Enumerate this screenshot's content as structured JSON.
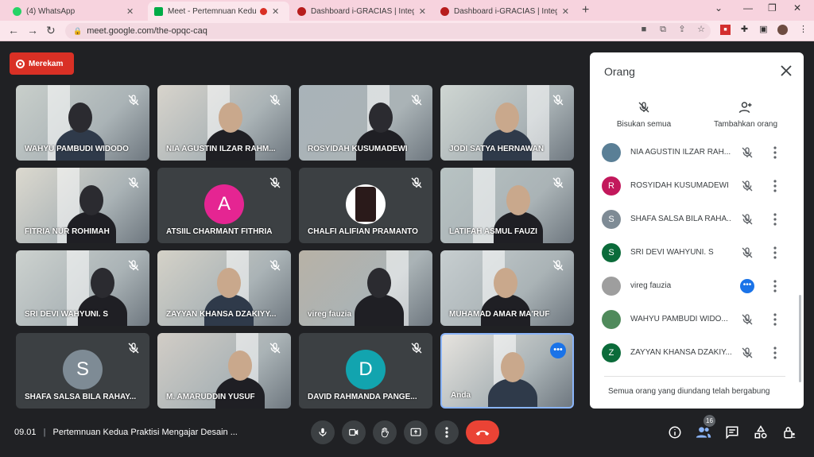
{
  "browser": {
    "tabs": [
      {
        "title": "(4) WhatsApp",
        "color": "#25d366"
      },
      {
        "title": "Meet - Pertemnuan Kedua P",
        "color": "#00ac47"
      },
      {
        "title": "Dashboard i-GRACIAS | Integrate",
        "color": "#b71c1c"
      },
      {
        "title": "Dashboard i-GRACIAS | Integrate",
        "color": "#b71c1c"
      }
    ],
    "url": "meet.google.com/the-opqc-caq",
    "new_tab": "+"
  },
  "recording": {
    "label": "Merekam"
  },
  "tiles": [
    {
      "name": "WAHYU PAMBUDI WIDODO",
      "kind": "video"
    },
    {
      "name": "NIA AGUSTIN ILZAR RAHM...",
      "kind": "video"
    },
    {
      "name": "ROSYIDAH KUSUMADEWI",
      "kind": "video"
    },
    {
      "name": "JODI SATYA HERNAWAN",
      "kind": "video"
    },
    {
      "name": "FITRIA NUR ROHIMAH",
      "kind": "video"
    },
    {
      "name": "ATSIIL CHARMANT FITHRIA",
      "kind": "avatar",
      "initial": "A",
      "color": "#e52592"
    },
    {
      "name": "CHALFI ALIFIAN PRAMANTO",
      "kind": "photo"
    },
    {
      "name": "LATIFAH ASMUL FAUZI",
      "kind": "video"
    },
    {
      "name": "SRI DEVI WAHYUNI. S",
      "kind": "video"
    },
    {
      "name": "ZAYYAN KHANSA DZAKIYY...",
      "kind": "video"
    },
    {
      "name": "vireg fauzia",
      "kind": "video"
    },
    {
      "name": "MUHAMAD AMAR MA'RUF",
      "kind": "video"
    },
    {
      "name": "SHAFA SALSA BILA RAHAY...",
      "kind": "avatar",
      "initial": "S",
      "color": "#7e8b95"
    },
    {
      "name": "M. AMARUDDIN YUSUF",
      "kind": "video"
    },
    {
      "name": "DAVID RAHMANDA PANGE...",
      "kind": "avatar",
      "initial": "D",
      "color": "#12a4af"
    },
    {
      "name": "Anda",
      "kind": "self"
    }
  ],
  "bottom_bar": {
    "time": "09.01",
    "separator": "|",
    "meeting_title": "Pertemnuan Kedua Praktisi Mengajar Desain ...",
    "people_count": "16"
  },
  "panel": {
    "title": "Orang",
    "mute_all_label": "Bisukan semua",
    "add_people_label": "Tambahkan orang",
    "participants": [
      {
        "name": "NIA AGUSTIN ILZAR RAH...",
        "initial": "",
        "color": "#5a7f96"
      },
      {
        "name": "ROSYIDAH KUSUMADEWI",
        "initial": "R",
        "color": "#c2185b"
      },
      {
        "name": "SHAFA SALSA BILA RAHA...",
        "initial": "S",
        "color": "#7e8b95"
      },
      {
        "name": "SRI DEVI WAHYUNI. S",
        "initial": "S",
        "color": "#0b6b3a"
      },
      {
        "name": "vireg fauzia",
        "initial": "",
        "color": "#9e9e9e"
      },
      {
        "name": "WAHYU PAMBUDI WIDO...",
        "initial": "",
        "color": "#4f8a5b"
      },
      {
        "name": "ZAYYAN KHANSA DZAKIY...",
        "initial": "Z",
        "color": "#0b6b3a"
      }
    ],
    "footer": "Semua orang yang diundang telah bergabung"
  }
}
